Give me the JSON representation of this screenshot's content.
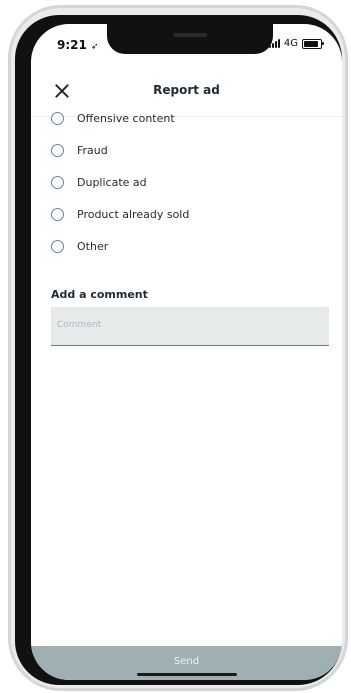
{
  "status_bar": {
    "time": "9:21",
    "network": "4G"
  },
  "header": {
    "title": "Report ad"
  },
  "options": [
    {
      "label": "Offensive content"
    },
    {
      "label": "Fraud"
    },
    {
      "label": "Duplicate ad"
    },
    {
      "label": "Product already sold"
    },
    {
      "label": "Other"
    }
  ],
  "comment": {
    "heading": "Add a comment",
    "placeholder": "Comment",
    "value": ""
  },
  "footer": {
    "send_label": "Send"
  },
  "colors": {
    "radio_border": "#5a8aa0",
    "send_bg": "#9fb0b4",
    "input_bg": "#e7eaeb"
  }
}
